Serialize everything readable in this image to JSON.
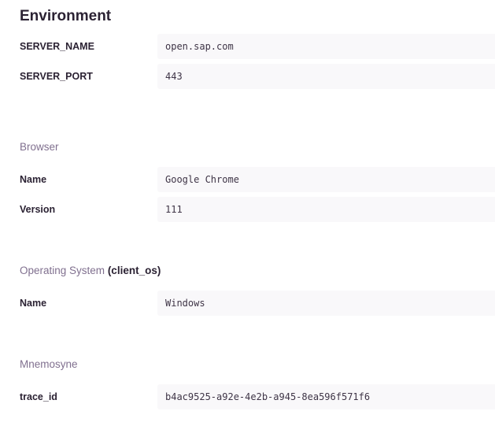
{
  "title": "Environment",
  "environment": [
    {
      "key": "SERVER_NAME",
      "value": "open.sap.com"
    },
    {
      "key": "SERVER_PORT",
      "value": "443"
    }
  ],
  "browser": {
    "title": "Browser",
    "rows": [
      {
        "key": "Name",
        "value": "Google Chrome"
      },
      {
        "key": "Version",
        "value": "111"
      }
    ]
  },
  "os": {
    "title": "Operating System",
    "alias": "(client_os)",
    "rows": [
      {
        "key": "Name",
        "value": "Windows"
      }
    ]
  },
  "mnemosyne": {
    "title": "Mnemosyne",
    "rows": [
      {
        "key": "trace_id",
        "value": "b4ac9525-a92e-4e2b-a945-8ea596f571f6"
      }
    ]
  }
}
